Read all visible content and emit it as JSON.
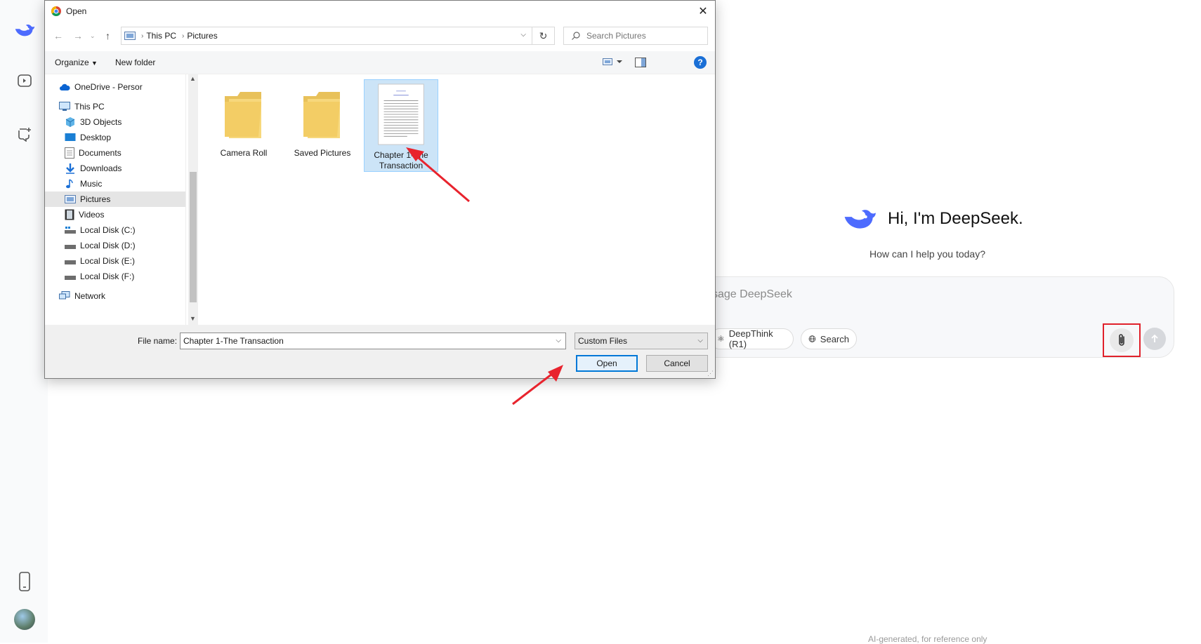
{
  "deepseek": {
    "greeting": "Hi, I'm DeepSeek.",
    "subtitle": "How can I help you today?",
    "input_placeholder": "ssage DeepSeek",
    "chip_deepthink": "DeepThink (R1)",
    "chip_search": "Search",
    "footer": "AI-generated, for reference only",
    "brand_color": "#4d6bfe",
    "highlight_color": "#e0212b"
  },
  "dialog": {
    "title": "Open",
    "address": {
      "crumbs": [
        "This PC",
        "Pictures"
      ]
    },
    "search_placeholder": "Search Pictures",
    "toolbar": {
      "organize": "Organize",
      "new_folder": "New folder",
      "help": "?"
    },
    "tree": [
      {
        "label": "OneDrive - Persor",
        "icon": "cloud-icon"
      },
      {
        "label": "This PC",
        "icon": "computer-icon"
      },
      {
        "label": "3D Objects",
        "icon": "cube-icon"
      },
      {
        "label": "Desktop",
        "icon": "desktop-icon"
      },
      {
        "label": "Documents",
        "icon": "document-icon"
      },
      {
        "label": "Downloads",
        "icon": "download-icon"
      },
      {
        "label": "Music",
        "icon": "music-icon"
      },
      {
        "label": "Pictures",
        "icon": "picture-icon",
        "selected": true
      },
      {
        "label": "Videos",
        "icon": "film-icon"
      },
      {
        "label": "Local Disk (C:)",
        "icon": "disk-icon"
      },
      {
        "label": "Local Disk (D:)",
        "icon": "disk-icon"
      },
      {
        "label": "Local Disk (E:)",
        "icon": "disk-icon"
      },
      {
        "label": "Local Disk (F:)",
        "icon": "disk-icon"
      },
      {
        "label": "Network",
        "icon": "network-icon"
      }
    ],
    "files": [
      {
        "label": "Camera Roll",
        "type": "folder"
      },
      {
        "label": "Saved Pictures",
        "type": "folder"
      },
      {
        "label": "Chapter 1-The Transaction",
        "type": "document",
        "selected": true
      }
    ],
    "file_name_label": "File name:",
    "file_name_value": "Chapter 1-The Transaction",
    "file_type": "Custom Files",
    "open_label": "Open",
    "cancel_label": "Cancel"
  }
}
